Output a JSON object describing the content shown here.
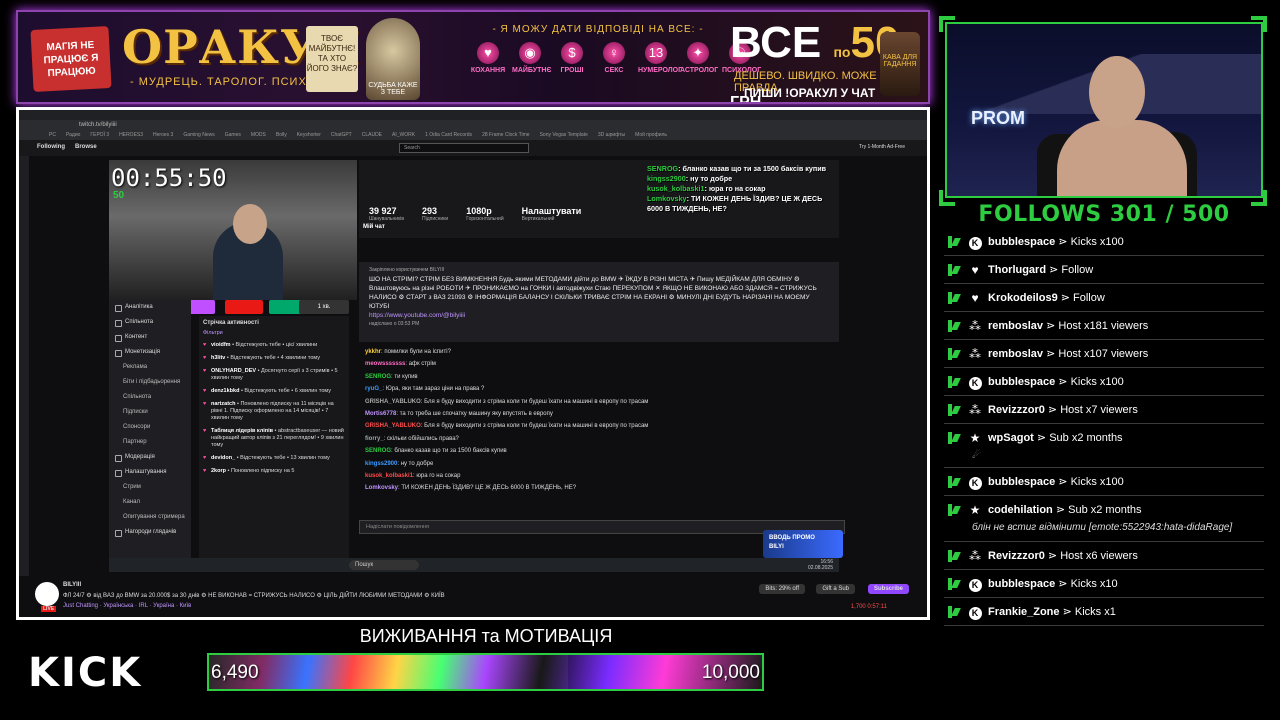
{
  "banner": {
    "tag": "МАГІЯ НЕ ПРАЦЮЄ Я ПРАЦЮЮ",
    "title": "ОРАКУЛ",
    "subtitle": "- МУДРЕЦЬ. ТАРОЛОГ. ПСИХОЛОГ -",
    "scroll": "ТВОЄ МАЙБУТНЄ! ТА ХТО ЙОГО ЗНАЄ?",
    "skull": "СУДЬБА КАЖЕ З ТЕБЕ",
    "question": "- Я МОЖУ ДАТИ ВІДПОВІДІ НА ВСЕ: -",
    "icons": [
      {
        "name": "heart-icon",
        "label": "КОХАННЯ",
        "glyph": "♥"
      },
      {
        "name": "crystal-ball-icon",
        "label": "МАЙБУТНЄ",
        "glyph": "◉"
      },
      {
        "name": "money-icon",
        "label": "ГРОШІ",
        "glyph": "$"
      },
      {
        "name": "sex-icon",
        "label": "СЕКС",
        "glyph": "♀"
      },
      {
        "name": "numerology-icon",
        "label": "НУМЕРОЛОГ",
        "glyph": "13"
      },
      {
        "name": "astrology-icon",
        "label": "АСТРОЛОГ",
        "glyph": "✦"
      },
      {
        "name": "brain-icon",
        "label": "ПСИХОЛОГ",
        "glyph": "☯"
      }
    ],
    "price_word": "ВСЕ",
    "price_prefix": "по",
    "price_number": "50",
    "price_currency": "ГРН.",
    "slogan1": "ДЕШЕВО. ШВИДКО. МОЖЕ БУТИ ПРАВДА.",
    "slogan2": "ПИШИ !ОРАКУЛ У ЧАТ",
    "jar": "КАВА ДЛЯ ГАДАННЯ"
  },
  "browser": {
    "url": "twitch.tv/bilyiiii",
    "bookmarks": [
      "PC",
      "Радио",
      "ГЕРОЇ 3",
      "HEROES3",
      "Heroes 3",
      "Gaming News",
      "Games",
      "MODS",
      "Bolly",
      "Keyshorter",
      "ChatGPT",
      "CLAUDE",
      "AI_WORK",
      "1 Odia Card Records",
      "28 Frame Clock Time",
      "Sony Vegas Template",
      "3D шрифты",
      "Мой профиль"
    ]
  },
  "twitch": {
    "nav_following": "Following",
    "nav_browse": "Browse",
    "search_placeholder": "Search",
    "ad_free": "Try 1-Month Ad-Free"
  },
  "inner_stream": {
    "timer": "00:55:50",
    "timer_sub": "50",
    "cam_button": "1 хв."
  },
  "dashboard": {
    "sidebar": [
      {
        "label": "Аналітика",
        "sub": false
      },
      {
        "label": "Спільнота",
        "sub": false
      },
      {
        "label": "Контент",
        "sub": false
      },
      {
        "label": "Монетизація",
        "sub": false
      },
      {
        "label": "Реклама",
        "sub": true
      },
      {
        "label": "Біти і підбадьорення",
        "sub": true
      },
      {
        "label": "Спільнота",
        "sub": true
      },
      {
        "label": "Підписки",
        "sub": true
      },
      {
        "label": "Спонсори",
        "sub": true
      },
      {
        "label": "Партнер",
        "sub": true
      },
      {
        "label": "Модерація",
        "sub": false
      },
      {
        "label": "Налаштування",
        "sub": false
      },
      {
        "label": "Стрим",
        "sub": true
      },
      {
        "label": "Канал",
        "sub": true
      },
      {
        "label": "Опитування стримера",
        "sub": true
      },
      {
        "label": "Нагороди глядачів",
        "sub": false
      }
    ],
    "activity_header": "Стрічка активності",
    "activity_filters": "Фільтри",
    "activity": [
      {
        "user": "vioidfm",
        "text": "• Відстежують тебе • цієї хвилини"
      },
      {
        "user": "h3litv",
        "text": "• Відстежують тебе • 4 хвилини тому"
      },
      {
        "user": "ONLYHARD_DEV",
        "text": "• Досягнуто серії з 3 стримів • 5 хвилин тому"
      },
      {
        "user": "denz1kbkd",
        "text": "• Відстежують тебе • 6 хвилин тому"
      },
      {
        "user": "nartzatch",
        "text": "• Поновлено підписку на 11 місяців на рівні 1. Підписку оформлено на 14 місяців! • 7 хвилин тому"
      },
      {
        "user": "Таблиця лідерів кліпів",
        "text": "• abstractbaseuser — новий найкращий автор кліпів з 21 переглядом! • 9 хвилин тому"
      },
      {
        "user": "devidon_",
        "text": "• Відстежують тебе • 13 хвилин тому"
      },
      {
        "user": "2korp",
        "text": "• Поновлено підписку на 5"
      }
    ],
    "stats": [
      {
        "value": "39 927",
        "label": "Шанувальників"
      },
      {
        "value": "293",
        "label": "Підписники"
      },
      {
        "value": "1080p",
        "label": "Горизонтальний"
      },
      {
        "value": "Налаштувати",
        "label": "Вертикальний"
      }
    ],
    "chat_mode": "Мій чат",
    "pinned_by": "Закріплено користувачем BILYIII",
    "pinned_text": "ШО НА СТРІМІ? СТРІМ БЕЗ ВИМКНЕННЯ Будь якими МЕТОДАМИ дійти до BMW ✈ ЇЖДУ В РІЗНІ МІСТА ✈ Пишу МЕДІЙКАМ ДЛЯ ОБМІНУ ⚙ Влаштовуюсь на різні РОБОТИ ✈ ПРОНИКАЄМО на ГОНКИ і автодвіжухи Стаю ПЕРЕКУПОМ ✕ ЯКЩО НЕ ВИКОНАЮ АБО ЗДАМСЯ = СТРИЖУСЬ НАЛИСО ⚙ СТАРТ з ВАЗ 21093 ⚙ ІНФОРМАЦІЯ БАЛАНСУ І СКІЛЬКИ ТРИВАЄ СТРІМ НА ЕКРАНІ ⚙ МИНУЛІ ДНІ БУДУТЬ НАРІЗАНІ НА МОЄМУ ЮТУБІ",
    "pinned_link": "https://www.youtube.com/@bilyiiii",
    "pinned_time": "надіслано о 03:53 PM",
    "chat": [
      {
        "user": "ykkhr",
        "text": "помилки були на іспиті?",
        "color": "#ffd23b"
      },
      {
        "user": "meowsssssss",
        "text": "афк стрім",
        "color": "#ff6ec7"
      },
      {
        "user": "SENROG",
        "text": "ти купив",
        "color": "#2ecc40"
      },
      {
        "user": "ryuG_",
        "text": "Юра, яки там зараз ціни на права ?",
        "color": "#3b9bff"
      },
      {
        "user": "GRISHA_YABLUKO",
        "text": "Бля я буду виходити з стріма коли ти будеш їхати на машині в европу по трасам",
        "color": "#aaa"
      },
      {
        "user": "Mortis6778",
        "text": "та то треба ше спочатку машину яку впустять в европу",
        "color": "#bf94ff"
      },
      {
        "user": "GRISHA_YABLUKO",
        "text": "Бля я буду виходити з стріма коли ти будеш їхати на машині в европу по трасам",
        "color": "#ff4d4d"
      },
      {
        "user": "fiorry_",
        "text": "скільки обійшлись права?",
        "color": "#9aa"
      },
      {
        "user": "SENROG",
        "text": "бланко казав що ти за 1500 баксів купив",
        "color": "#2ecc40"
      },
      {
        "user": "kingss2900",
        "text": "ну то добре",
        "color": "#3b9bff"
      },
      {
        "user": "kusok_kolbaski1",
        "text": "юра го на сокар",
        "color": "#ff4d4d"
      },
      {
        "user": "Lomkovsky",
        "text": "ТИ КОЖЕН ДЕНЬ ЇЗДИВ? ЦЕ Ж ДЕСЬ 6000 В ТИЖДЕНЬ, НЕ?",
        "color": "#bf94ff"
      }
    ],
    "send_placeholder": "Надіслати повідомлення"
  },
  "overlay_chat": [
    {
      "user": "SENROG",
      "text": "бланко казав що ти за 1500 баксів купив"
    },
    {
      "user": "kingss2900",
      "text": "ну то добре"
    },
    {
      "user": "kusok_kolbaski1",
      "text": "юра го на сокар"
    },
    {
      "user": "Lomkovsky",
      "text": "ТИ КОЖЕН ДЕНЬ ЇЗДИВ? ЦЕ Ж ДЕСЬ 6000 В ТИЖДЕНЬ, НЕ?"
    }
  ],
  "promo": {
    "line1": "ВВОДЬ ПРОМО",
    "line2": "BILYI"
  },
  "taskbar": {
    "search": "Пошук",
    "time": "16:56",
    "date": "02.08.2025"
  },
  "stream_info": {
    "name": "BILYIII",
    "live": "LIVE",
    "title": "ФЛ 24/7 ⚙ від ВАЗ до BMW за 20.000$ за 30 днів ⚙ НЕ ВИКОНАВ = СТРИЖУСЬ НАЛИСО ⚙ ЦІЛЬ ДІЙТИ ЛЮБИМИ МЕТОДАМИ ⚙ КИЇВ",
    "category": "Just Chatting · Українська · IRL · Україна · Київ",
    "discount": "Bits: 29% off",
    "gift": "Gift a Sub",
    "subscribe": "Subscribe",
    "viewers": "1,700  0:57:11"
  },
  "bottom": {
    "logo": "KICK",
    "goal_title": "ВИЖИВАННЯ та МОТИВАЦІЯ",
    "goal_current": "6,490",
    "goal_max": "10,000",
    "goal_progress": 0.649
  },
  "cam": {
    "sign": "PROM"
  },
  "follows": "FOLLOWS 301 / 500",
  "events": [
    {
      "user": "bubblespace",
      "action": "Kicks x100",
      "icon": "kick-circle-icon",
      "glyph": "K"
    },
    {
      "user": "Thorlugard",
      "action": "Follow",
      "icon": "heart-icon",
      "glyph": "♥"
    },
    {
      "user": "Krokodeilos9",
      "action": "Follow",
      "icon": "heart-icon",
      "glyph": "♥"
    },
    {
      "user": "remboslav",
      "action": "Host x181 viewers",
      "icon": "host-icon",
      "glyph": "⁂"
    },
    {
      "user": "remboslav",
      "action": "Host x107 viewers",
      "icon": "host-icon",
      "glyph": "⁂"
    },
    {
      "user": "bubblespace",
      "action": "Kicks x100",
      "icon": "kick-circle-icon",
      "glyph": "K"
    },
    {
      "user": "Revizzzor0",
      "action": "Host x7 viewers",
      "icon": "host-icon",
      "glyph": "⁂"
    },
    {
      "user": "wpSagot",
      "action": "Sub x2 months",
      "icon": "star-icon",
      "glyph": "★",
      "extra": "☄"
    },
    {
      "user": "bubblespace",
      "action": "Kicks x100",
      "icon": "kick-circle-icon",
      "glyph": "K"
    },
    {
      "user": "codehilation",
      "action": "Sub x2 months",
      "icon": "star-icon",
      "glyph": "★",
      "msg": "блін не встиг відмінити [emote:5522943:hata-didaRage]"
    },
    {
      "user": "Revizzzor0",
      "action": "Host x6 viewers",
      "icon": "host-icon",
      "glyph": "⁂"
    },
    {
      "user": "bubblespace",
      "action": "Kicks x10",
      "icon": "kick-circle-icon",
      "glyph": "K"
    },
    {
      "user": "Frankie_Zone",
      "action": "Kicks x1",
      "icon": "kick-circle-icon",
      "glyph": "K"
    }
  ],
  "colors": {
    "accent": "#2ecc40",
    "twitch": "#9147ff",
    "oracle_gold": "#f4c242"
  }
}
